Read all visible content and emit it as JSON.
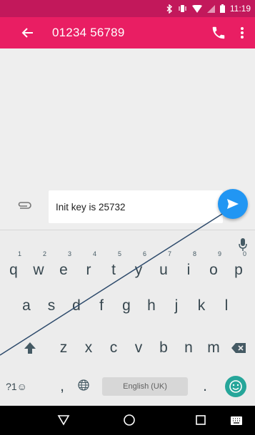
{
  "status_bar": {
    "time": "11:19",
    "icons": [
      "bluetooth-icon",
      "vibrate-icon",
      "wifi-icon",
      "signal-icon",
      "battery-icon"
    ]
  },
  "toolbar": {
    "title": "01234 56789",
    "color": "#e91e63",
    "status_color": "#c2185b"
  },
  "compose": {
    "message": "Init key is 25732",
    "send_color": "#2196f3"
  },
  "keyboard": {
    "row1": [
      {
        "label": "q",
        "hint": "1"
      },
      {
        "label": "w",
        "hint": "2"
      },
      {
        "label": "e",
        "hint": "3"
      },
      {
        "label": "r",
        "hint": "4"
      },
      {
        "label": "t",
        "hint": "5"
      },
      {
        "label": "y",
        "hint": "6"
      },
      {
        "label": "u",
        "hint": "7"
      },
      {
        "label": "i",
        "hint": "8"
      },
      {
        "label": "o",
        "hint": "9"
      },
      {
        "label": "p",
        "hint": "0"
      }
    ],
    "row2": [
      "a",
      "s",
      "d",
      "f",
      "g",
      "h",
      "j",
      "k",
      "l"
    ],
    "row3": [
      "z",
      "x",
      "c",
      "v",
      "b",
      "n",
      "m"
    ],
    "symbols_label": "?1☺",
    "comma_label": ",",
    "period_label": ".",
    "space_label": "English (UK)",
    "emoji_color": "#26a69a"
  }
}
